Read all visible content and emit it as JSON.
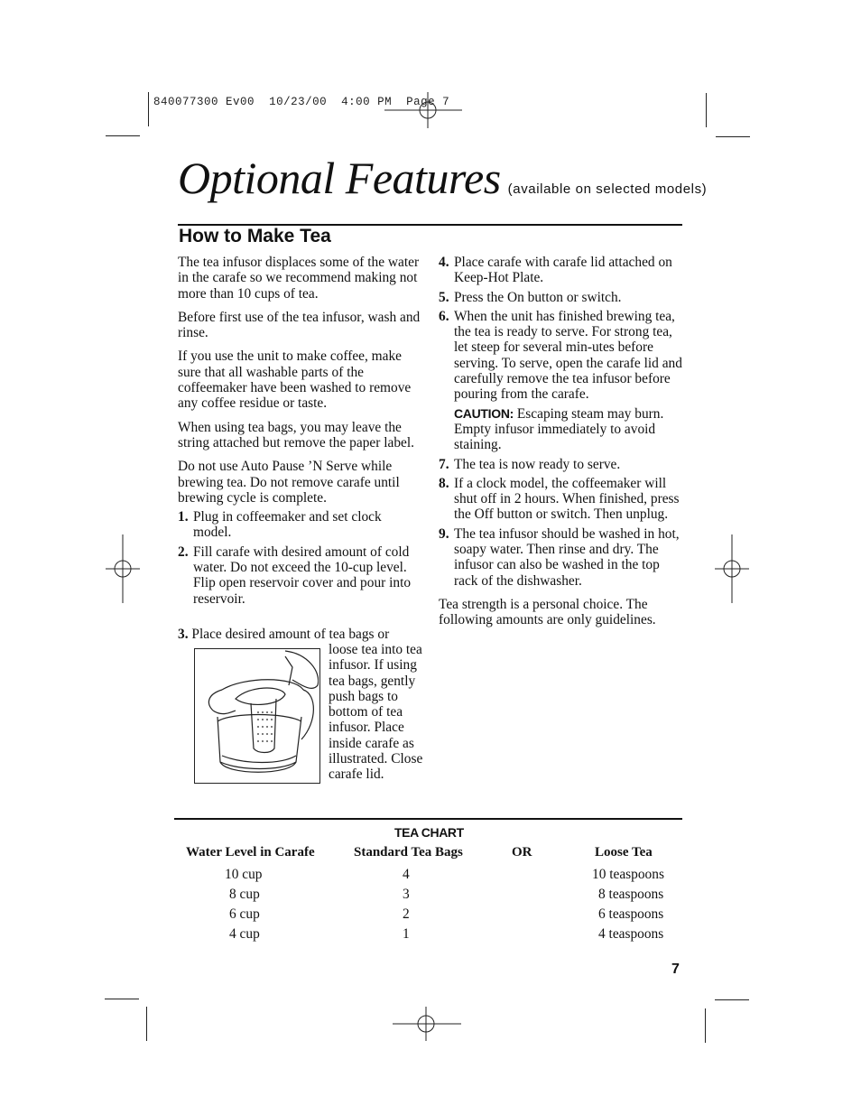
{
  "print_slug": {
    "job_number": "840077300",
    "version": "Ev00",
    "date": "10/23/00",
    "time": "4:00 PM",
    "page_label": "Page 7"
  },
  "header": {
    "title": "Optional Features",
    "subtitle": "(available on selected models)"
  },
  "section": {
    "title": "How to Make Tea"
  },
  "left_column": {
    "paragraphs": [
      "The tea infusor displaces some of the water in the carafe so we recommend making not more than 10 cups of tea.",
      "Before first use of the tea infusor, wash and rinse.",
      "If you use the unit to make coffee, make sure that all washable parts of the coffeemaker have been washed to remove any coffee residue or taste.",
      "When using tea bags, you may leave the string attached but remove the paper label.",
      "Do not use Auto Pause ’N Serve while brewing tea. Do not remove carafe until brewing cycle is complete."
    ],
    "steps": [
      {
        "num": "1.",
        "text": "Plug in coffeemaker and set clock model."
      },
      {
        "num": "2.",
        "text": "Fill carafe with desired amount of cold water. Do not exceed the 10-cup level. Flip open reservoir cover and pour into reservoir."
      },
      {
        "num": "3.",
        "text_first": "Place desired amount of tea bags or",
        "text_side": "loose tea into tea infusor. If using tea bags, gently push bags to bottom of tea infusor. Place inside carafe as illustrated. Close carafe lid."
      }
    ],
    "illustration": {
      "icon": "carafe-with-tea-infusor-illustration"
    }
  },
  "right_column": {
    "steps": [
      {
        "num": "4.",
        "text": "Place carafe with carafe lid attached on Keep-Hot Plate."
      },
      {
        "num": "5.",
        "text": "Press the On button or switch."
      },
      {
        "num": "6.",
        "text": "When the unit has finished brewing tea, the tea is ready to serve. For strong tea, let steep for several min-utes before serving. To serve, open the carafe lid and carefully remove the tea infusor before pouring from the carafe.",
        "caution_label": "CAUTION:",
        "caution_text": "Escaping steam may burn. Empty infusor immediately to avoid staining."
      },
      {
        "num": "7.",
        "text": "The tea is now ready to serve."
      },
      {
        "num": "8.",
        "text": "If a clock model, the coffeemaker will shut off in 2 hours. When finished, press the Off button or switch. Then unplug."
      },
      {
        "num": "9.",
        "text": "The tea infusor should be washed in hot, soapy water. Then rinse and dry. The infusor can also be washed in the top rack of the dishwasher."
      }
    ],
    "closing_paragraph": "Tea strength is a personal choice. The following amounts are only guidelines."
  },
  "tea_chart": {
    "title": "TEA CHART",
    "headers": [
      "Water Level in Carafe",
      "Standard Tea Bags",
      "OR",
      "Loose Tea"
    ],
    "rows": [
      [
        "10 cup",
        "4",
        "10 teaspoons"
      ],
      [
        "8 cup",
        "3",
        "8 teaspoons"
      ],
      [
        "6 cup",
        "2",
        "6 teaspoons"
      ],
      [
        "4 cup",
        "1",
        "4 teaspoons"
      ]
    ]
  },
  "footer": {
    "page_number": "7"
  },
  "crop_marks": {
    "icon": "registration-mark-icon"
  }
}
